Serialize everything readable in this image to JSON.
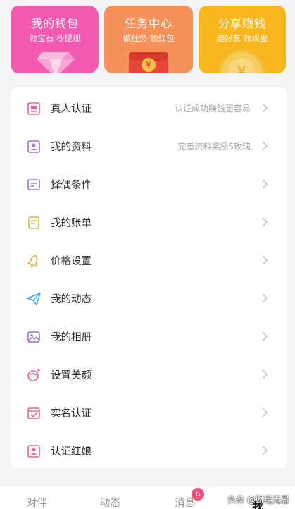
{
  "cards": [
    {
      "title": "我的钱包",
      "subtitle": "领宝石 秒提现"
    },
    {
      "title": "任务中心",
      "subtitle": "做任务 领红包"
    },
    {
      "title": "分享赚钱",
      "subtitle": "邀好友 领现金"
    }
  ],
  "menu": [
    {
      "label": "真人认证",
      "hint": "认证成功赚钱更容易",
      "icon": "id-card-icon"
    },
    {
      "label": "我的资料",
      "hint": "完善资料奖励5玫瑰",
      "icon": "profile-icon"
    },
    {
      "label": "择偶条件",
      "hint": "",
      "icon": "criteria-icon"
    },
    {
      "label": "我的账单",
      "hint": "",
      "icon": "bill-icon"
    },
    {
      "label": "价格设置",
      "hint": "",
      "icon": "bell-icon"
    },
    {
      "label": "我的动态",
      "hint": "",
      "icon": "paper-plane-icon"
    },
    {
      "label": "我的相册",
      "hint": "",
      "icon": "photo-icon"
    },
    {
      "label": "设置美颜",
      "hint": "",
      "icon": "beauty-icon"
    },
    {
      "label": "实名认证",
      "hint": "",
      "icon": "check-calendar-icon"
    },
    {
      "label": "认证红娘",
      "hint": "",
      "icon": "matchmaker-icon"
    }
  ],
  "tabbar": {
    "items": [
      "对伴",
      "动态",
      "消息",
      "我"
    ],
    "active": "我",
    "message_badge": "6"
  },
  "watermark": "头条 @财经无忌",
  "colors": {
    "wallet": "#f45ab2",
    "task": "#f6915c",
    "share": "#f9b61f",
    "icon_pink": "#e9608f",
    "icon_purple": "#9b6fd3",
    "icon_yellow": "#e3b43b",
    "icon_blue": "#52a6e8"
  }
}
